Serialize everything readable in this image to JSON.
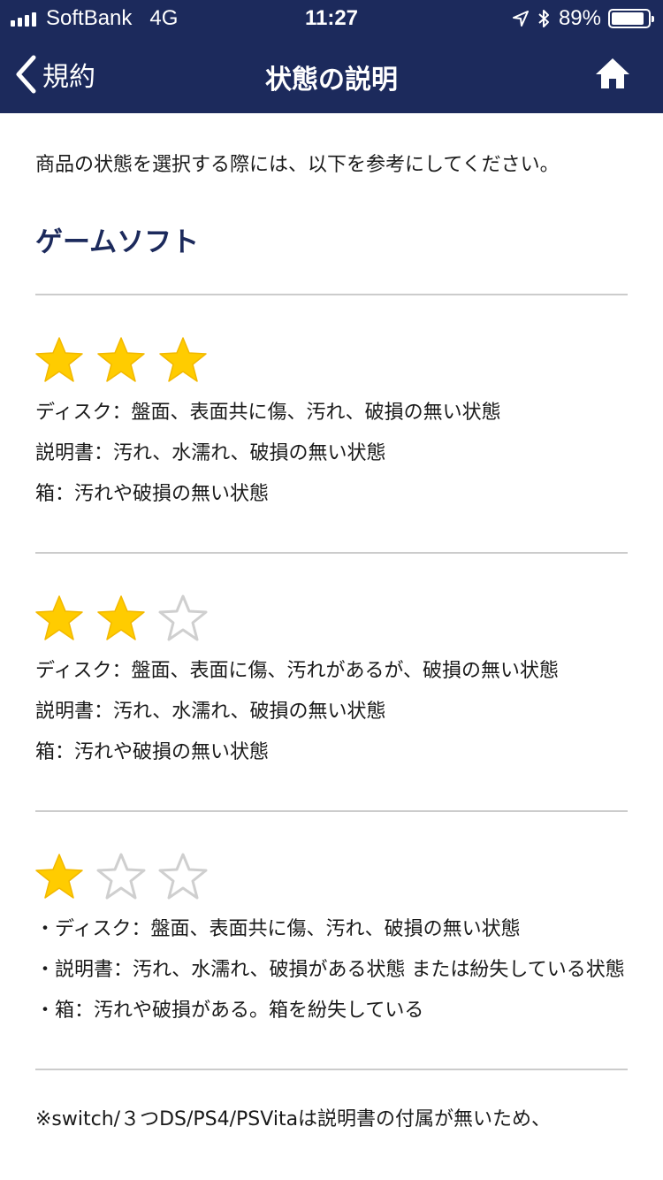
{
  "status_bar": {
    "carrier": "SoftBank",
    "network": "4G",
    "time": "11:27",
    "battery": "89%",
    "battery_level": 0.89
  },
  "nav": {
    "back_label": "規約",
    "title": "状態の説明"
  },
  "intro": "商品の状態を選択する際には、以下を参考にしてください。",
  "section_title": "ゲームソフト",
  "conditions": [
    {
      "rating": 3,
      "lines": [
        "ディスク：盤面、表面共に傷、汚れ、破損の無い状態",
        "説明書：汚れ、水濡れ、破損の無い状態",
        "箱：汚れや破損の無い状態"
      ]
    },
    {
      "rating": 2,
      "lines": [
        "ディスク：盤面、表面に傷、汚れがあるが、破損の無い状態",
        "説明書：汚れ、水濡れ、破損の無い状態",
        "箱：汚れや破損の無い状態"
      ]
    },
    {
      "rating": 1,
      "lines": [
        "・ディスク：盤面、表面共に傷、汚れ、破損の無い状態",
        "・説明書：汚れ、水濡れ、破損がある状態 または紛失している状態",
        "・箱：汚れや破損がある。箱を紛失している"
      ]
    }
  ],
  "note": "※switch/３つDS/PS4/PSVitaは説明書の付属が無いため、",
  "colors": {
    "nav_background": "#1c2a5c",
    "star_filled": "#ffcc00",
    "star_empty_outline": "#cfcfcf",
    "section_title": "#1c2a5c"
  },
  "icons": {
    "back": "chevron-left-icon",
    "home": "home-icon",
    "location": "location-arrow-icon",
    "bluetooth": "bluetooth-icon"
  }
}
